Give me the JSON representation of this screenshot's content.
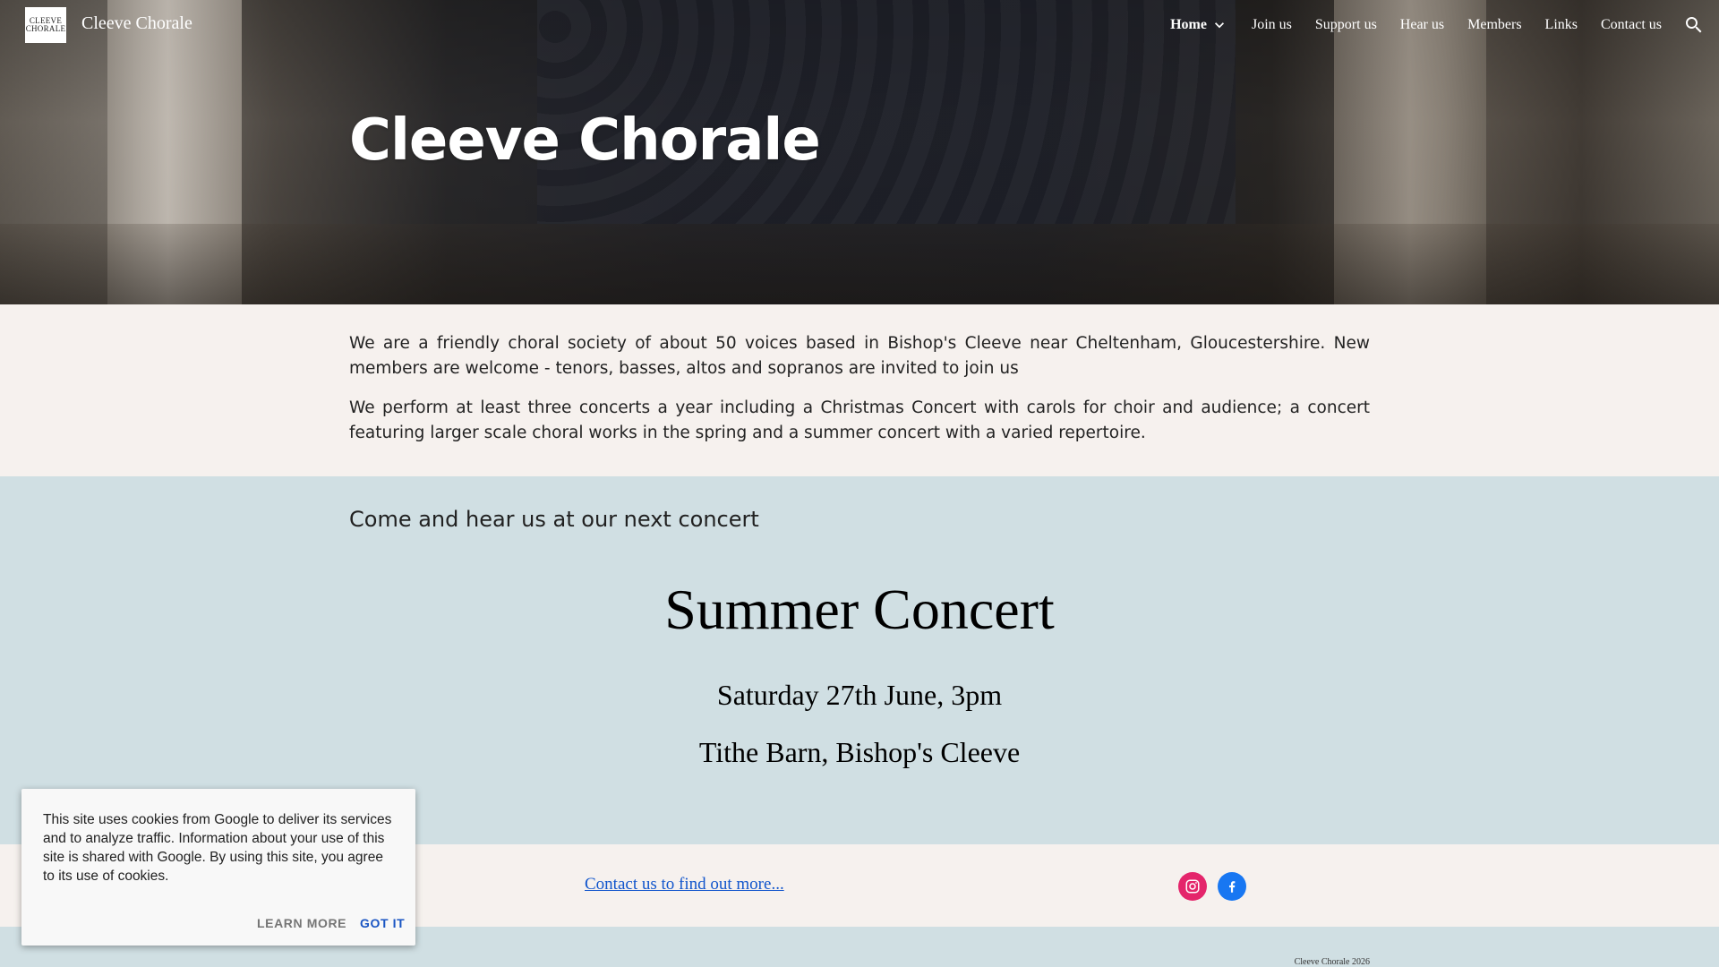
{
  "site": {
    "logo_line1": "CLEEVE",
    "logo_line2": "CHORALE",
    "title": "Cleeve Chorale"
  },
  "nav": {
    "items": [
      {
        "label": "Home",
        "active": true,
        "has_dropdown": true
      },
      {
        "label": "Join us"
      },
      {
        "label": "Support us"
      },
      {
        "label": "Hear us"
      },
      {
        "label": "Members"
      },
      {
        "label": "Links"
      },
      {
        "label": "Contact us"
      }
    ],
    "search_icon": "search-icon"
  },
  "hero": {
    "title": "Cleeve Chorale"
  },
  "intro": {
    "paragraph1": "We are a friendly choral society of about 50 voices based in Bishop's Cleeve near Cheltenham, Gloucestershire.  New members are welcome - tenors, basses, altos and sopranos are invited to join us",
    "paragraph2": "We perform at least three concerts a year including a Christmas Concert with carols for choir and audience; a concert featuring larger scale choral works in the spring and a summer concert with a varied repertoire."
  },
  "concert": {
    "subheading": "Come and hear us at our next concert",
    "title": "Summer Concert",
    "date": "Saturday 27th June, 3pm",
    "venue": "Tithe Barn, Bishop's Cleeve"
  },
  "contact": {
    "link_text": "Contact us to find out more...",
    "social": [
      {
        "name": "instagram-icon",
        "color": "#e4256b"
      },
      {
        "name": "facebook-icon",
        "color": "#1877f2"
      }
    ]
  },
  "footer": {
    "copyright": "Cleeve Chorale 2026"
  },
  "cookie": {
    "message": "This site uses cookies from Google to deliver its services and to analyze traffic. Information about your use of this site is shared with Google. By using this site, you agree to its use of cookies.",
    "learn_more": "LEARN MORE",
    "got_it": "GOT IT"
  },
  "colors": {
    "intro_bg": "#f6f1ee",
    "concert_bg": "#d0dfe3",
    "link": "#1155cc",
    "accent_button": "#1a55c3"
  }
}
